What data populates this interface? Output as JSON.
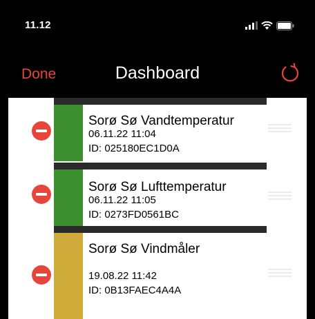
{
  "status_bar": {
    "time": "11.12",
    "icons": [
      "cellular-signal-icon",
      "wifi-icon",
      "battery-icon"
    ]
  },
  "nav": {
    "done_label": "Done",
    "title": "Dashboard",
    "refresh_icon": "refresh-icon"
  },
  "colors": {
    "accent": "#e8453a",
    "green": "#3d8f2f",
    "yellow": "#cfac3a"
  },
  "items": [
    {
      "title": "Sorø Sø Vandtemperatur",
      "date": "06.11.22   11:04",
      "id": "ID: 025180EC1D0A",
      "status_color": "green"
    },
    {
      "title": "Sorø Sø Lufttemperatur",
      "date": "06.11.22   11:05",
      "id": "ID: 0273FD0561BC",
      "status_color": "green"
    },
    {
      "title": "Sorø Sø Vindmåler",
      "date": "19.08.22   11:42",
      "id": "ID: 0B13FAEC4A4A",
      "status_color": "yellow"
    }
  ]
}
